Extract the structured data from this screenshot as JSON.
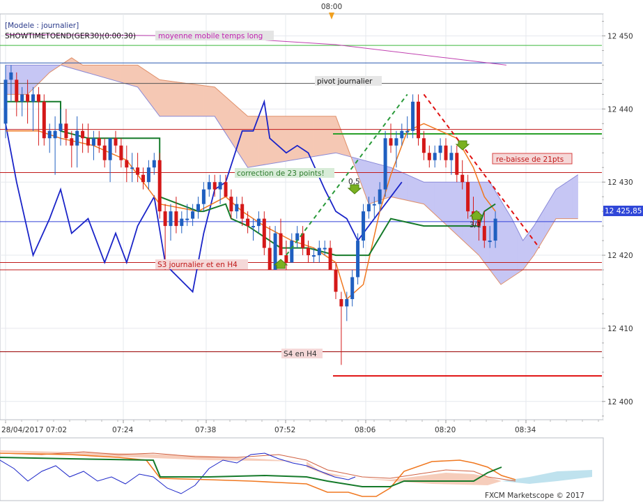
{
  "top_time_marker": "08:00",
  "info": {
    "model": "[Modele : journalier]",
    "symbol": "SHOWTIMETOEND(GER30)(0:00:30)",
    "ma_label": "moyenne mobile temps long"
  },
  "annotations": {
    "pivot": "pivot journalier",
    "correction": "correction de 23 points!",
    "s3": "S3 journalier et en H4",
    "s4": "S4 en H4",
    "rebaisse": "re-baisse de 21pts",
    "fib_a": "0,5",
    "fib_b": "3/1"
  },
  "price_tag": "12 425,85",
  "footer": "FXCM Marketscope © 2017",
  "colors": {
    "up": "#1f5fc0",
    "down": "#d41818",
    "kijun": "#157a2a",
    "tenkan": "#f07820",
    "chikou": "#1a24c8",
    "cloud_red": "#f5c8b4",
    "cloud_blue": "#c6c6f4",
    "ma": "#c040b0"
  },
  "chart_data": {
    "type": "candlestick",
    "ylabels": [
      "12 450",
      "12 440",
      "12 430",
      "12 420",
      "12 410",
      "12 400"
    ],
    "xlabels": [
      "28/04/2017 07:02",
      "07:24",
      "07:38",
      "07:52",
      "08:06",
      "08:20",
      "08:34"
    ],
    "ylim": [
      12397.5,
      12453
    ],
    "levels": {
      "ma_horizontal": 12448.7,
      "blue_level": 12446.3,
      "pivot_journalier": 12443.5,
      "red_r1": 12437.2,
      "green_r": 12436.6,
      "red_r2": 12431.3,
      "s3_a": 12419,
      "s3_b": 12418,
      "s4": 12406.8,
      "s4_future": 12403.5,
      "current": 12424.6
    },
    "candles": [
      {
        "o": 12438,
        "h": 12446,
        "l": 12436,
        "c": 12444
      },
      {
        "o": 12444,
        "h": 12446,
        "l": 12441,
        "c": 12445
      },
      {
        "o": 12444,
        "h": 12445,
        "l": 12439,
        "c": 12441
      },
      {
        "o": 12441,
        "h": 12443,
        "l": 12439,
        "c": 12442
      },
      {
        "o": 12442,
        "h": 12444,
        "l": 12438,
        "c": 12441
      },
      {
        "o": 12441,
        "h": 12443,
        "l": 12437,
        "c": 12442
      },
      {
        "o": 12442,
        "h": 12443,
        "l": 12435,
        "c": 12441
      },
      {
        "o": 12441,
        "h": 12442,
        "l": 12435,
        "c": 12436
      },
      {
        "o": 12436,
        "h": 12438,
        "l": 12434,
        "c": 12437
      },
      {
        "o": 12436,
        "h": 12439,
        "l": 12431,
        "c": 12437
      },
      {
        "o": 12437,
        "h": 12440,
        "l": 12435,
        "c": 12438
      },
      {
        "o": 12438,
        "h": 12440,
        "l": 12435,
        "c": 12436
      },
      {
        "o": 12436,
        "h": 12437,
        "l": 12432,
        "c": 12435
      },
      {
        "o": 12435,
        "h": 12439,
        "l": 12432,
        "c": 12437
      },
      {
        "o": 12437,
        "h": 12438,
        "l": 12434,
        "c": 12436
      },
      {
        "o": 12436,
        "h": 12438,
        "l": 12434,
        "c": 12435
      },
      {
        "o": 12435,
        "h": 12437,
        "l": 12433,
        "c": 12436
      },
      {
        "o": 12436,
        "h": 12437,
        "l": 12434,
        "c": 12435
      },
      {
        "o": 12435,
        "h": 12436,
        "l": 12432,
        "c": 12433
      },
      {
        "o": 12433,
        "h": 12436,
        "l": 12430,
        "c": 12436
      },
      {
        "o": 12436,
        "h": 12437,
        "l": 12434,
        "c": 12435
      },
      {
        "o": 12435,
        "h": 12436,
        "l": 12432,
        "c": 12433
      },
      {
        "o": 12433,
        "h": 12435,
        "l": 12430,
        "c": 12432
      },
      {
        "o": 12432,
        "h": 12434,
        "l": 12430,
        "c": 12432
      },
      {
        "o": 12432,
        "h": 12434,
        "l": 12430,
        "c": 12431
      },
      {
        "o": 12431,
        "h": 12432,
        "l": 12429,
        "c": 12430
      },
      {
        "o": 12430,
        "h": 12433,
        "l": 12429,
        "c": 12432
      },
      {
        "o": 12432,
        "h": 12434,
        "l": 12431,
        "c": 12433
      },
      {
        "o": 12433,
        "h": 12434,
        "l": 12425,
        "c": 12426
      },
      {
        "o": 12426,
        "h": 12427,
        "l": 12418,
        "c": 12424
      },
      {
        "o": 12424,
        "h": 12427,
        "l": 12422,
        "c": 12426
      },
      {
        "o": 12426,
        "h": 12428,
        "l": 12423,
        "c": 12424
      },
      {
        "o": 12424,
        "h": 12426,
        "l": 12423,
        "c": 12425
      },
      {
        "o": 12425,
        "h": 12427,
        "l": 12424,
        "c": 12425
      },
      {
        "o": 12425,
        "h": 12427,
        "l": 12424,
        "c": 12426
      },
      {
        "o": 12426,
        "h": 12428,
        "l": 12425,
        "c": 12427
      },
      {
        "o": 12427,
        "h": 12430,
        "l": 12426,
        "c": 12429
      },
      {
        "o": 12429,
        "h": 12431,
        "l": 12428,
        "c": 12430
      },
      {
        "o": 12430,
        "h": 12431,
        "l": 12428,
        "c": 12429
      },
      {
        "o": 12429,
        "h": 12431,
        "l": 12427,
        "c": 12430
      },
      {
        "o": 12430,
        "h": 12431,
        "l": 12428,
        "c": 12428
      },
      {
        "o": 12428,
        "h": 12429,
        "l": 12425,
        "c": 12426
      },
      {
        "o": 12426,
        "h": 12428,
        "l": 12425,
        "c": 12427
      },
      {
        "o": 12427,
        "h": 12428,
        "l": 12424,
        "c": 12425
      },
      {
        "o": 12425,
        "h": 12426,
        "l": 12423,
        "c": 12424
      },
      {
        "o": 12424,
        "h": 12425,
        "l": 12422,
        "c": 12424
      },
      {
        "o": 12424,
        "h": 12426,
        "l": 12423,
        "c": 12425
      },
      {
        "o": 12425,
        "h": 12426,
        "l": 12420,
        "c": 12421
      },
      {
        "o": 12421,
        "h": 12424,
        "l": 12418,
        "c": 12418
      },
      {
        "o": 12418,
        "h": 12424,
        "l": 12418,
        "c": 12423
      },
      {
        "o": 12423,
        "h": 12425,
        "l": 12420,
        "c": 12420
      },
      {
        "o": 12420,
        "h": 12422,
        "l": 12418,
        "c": 12419
      },
      {
        "o": 12419,
        "h": 12423,
        "l": 12419,
        "c": 12422
      },
      {
        "o": 12422,
        "h": 12424,
        "l": 12421,
        "c": 12423
      },
      {
        "o": 12423,
        "h": 12424,
        "l": 12420,
        "c": 12421
      },
      {
        "o": 12421,
        "h": 12422,
        "l": 12419,
        "c": 12420
      },
      {
        "o": 12420,
        "h": 12421,
        "l": 12419,
        "c": 12420
      },
      {
        "o": 12420,
        "h": 12422,
        "l": 12419,
        "c": 12421
      },
      {
        "o": 12421,
        "h": 12422,
        "l": 12420,
        "c": 12421
      },
      {
        "o": 12421,
        "h": 12422,
        "l": 12418,
        "c": 12418
      },
      {
        "o": 12418,
        "h": 12419,
        "l": 12414,
        "c": 12415
      },
      {
        "o": 12414,
        "h": 12415,
        "l": 12405,
        "c": 12413
      },
      {
        "o": 12413,
        "h": 12415,
        "l": 12411,
        "c": 12414
      },
      {
        "o": 12414,
        "h": 12418,
        "l": 12413,
        "c": 12417
      },
      {
        "o": 12417,
        "h": 12423,
        "l": 12416,
        "c": 12422
      },
      {
        "o": 12422,
        "h": 12427,
        "l": 12421,
        "c": 12426
      },
      {
        "o": 12426,
        "h": 12428,
        "l": 12425,
        "c": 12427
      },
      {
        "o": 12427,
        "h": 12428,
        "l": 12425,
        "c": 12427
      },
      {
        "o": 12427,
        "h": 12430,
        "l": 12426,
        "c": 12429
      },
      {
        "o": 12429,
        "h": 12437,
        "l": 12428,
        "c": 12436
      },
      {
        "o": 12436,
        "h": 12438,
        "l": 12434,
        "c": 12435
      },
      {
        "o": 12435,
        "h": 12437,
        "l": 12432,
        "c": 12436
      },
      {
        "o": 12436,
        "h": 12438,
        "l": 12435,
        "c": 12437
      },
      {
        "o": 12437,
        "h": 12439,
        "l": 12436,
        "c": 12437
      },
      {
        "o": 12437,
        "h": 12442,
        "l": 12436,
        "c": 12441
      },
      {
        "o": 12441,
        "h": 12442,
        "l": 12435,
        "c": 12436
      },
      {
        "o": 12436,
        "h": 12437,
        "l": 12433,
        "c": 12434
      },
      {
        "o": 12434,
        "h": 12435,
        "l": 12432,
        "c": 12433
      },
      {
        "o": 12433,
        "h": 12435,
        "l": 12432,
        "c": 12434
      },
      {
        "o": 12434,
        "h": 12436,
        "l": 12433,
        "c": 12435
      },
      {
        "o": 12435,
        "h": 12436,
        "l": 12432,
        "c": 12433
      },
      {
        "o": 12433,
        "h": 12435,
        "l": 12431,
        "c": 12434
      },
      {
        "o": 12434,
        "h": 12435,
        "l": 12430,
        "c": 12431
      },
      {
        "o": 12431,
        "h": 12433,
        "l": 12429,
        "c": 12430
      },
      {
        "o": 12430,
        "h": 12431,
        "l": 12425,
        "c": 12426
      },
      {
        "o": 12426,
        "h": 12428,
        "l": 12424,
        "c": 12425
      },
      {
        "o": 12425,
        "h": 12426,
        "l": 12422,
        "c": 12424
      },
      {
        "o": 12424,
        "h": 12426,
        "l": 12421,
        "c": 12422
      },
      {
        "o": 12422,
        "h": 12424,
        "l": 12421,
        "c": 12422
      },
      {
        "o": 12422,
        "h": 12426,
        "l": 12421,
        "c": 12425
      }
    ],
    "indicators": {
      "kijun": [
        [
          0,
          12441
        ],
        [
          10,
          12441
        ],
        [
          10,
          12437
        ],
        [
          15,
          12436
        ],
        [
          28,
          12436
        ],
        [
          28,
          12428
        ],
        [
          35,
          12426
        ],
        [
          36,
          12426
        ],
        [
          40,
          12427
        ],
        [
          41,
          12425
        ],
        [
          44,
          12424
        ],
        [
          46,
          12423
        ],
        [
          50,
          12421
        ],
        [
          55,
          12421
        ],
        [
          60,
          12420
        ],
        [
          66,
          12420
        ],
        [
          70,
          12425
        ],
        [
          76,
          12424
        ],
        [
          86,
          12424
        ],
        [
          87,
          12426
        ],
        [
          89,
          12427
        ]
      ],
      "tenkan": [
        [
          0,
          12437
        ],
        [
          6,
          12437
        ],
        [
          10,
          12436
        ],
        [
          16,
          12435
        ],
        [
          22,
          12433
        ],
        [
          28,
          12427
        ],
        [
          35,
          12426
        ],
        [
          40,
          12428
        ],
        [
          43,
          12426
        ],
        [
          47,
          12424
        ],
        [
          52,
          12422
        ],
        [
          56,
          12421
        ],
        [
          60,
          12419
        ],
        [
          62,
          12414
        ],
        [
          65,
          12416
        ],
        [
          68,
          12426
        ],
        [
          70,
          12431
        ],
        [
          73,
          12437
        ],
        [
          76,
          12438
        ],
        [
          79,
          12437
        ],
        [
          82,
          12436
        ],
        [
          85,
          12432
        ],
        [
          87,
          12428
        ],
        [
          89,
          12426
        ]
      ],
      "chikou": [
        [
          0,
          12438
        ],
        [
          2,
          12430
        ],
        [
          5,
          12420
        ],
        [
          8,
          12425
        ],
        [
          10,
          12429
        ],
        [
          12,
          12423
        ],
        [
          15,
          12425
        ],
        [
          18,
          12419
        ],
        [
          20,
          12423
        ],
        [
          22,
          12419
        ],
        [
          24,
          12424
        ],
        [
          27,
          12428
        ],
        [
          29,
          12419
        ],
        [
          30,
          12418
        ],
        [
          34,
          12415
        ],
        [
          36,
          12423
        ],
        [
          38,
          12429
        ],
        [
          40,
          12430
        ],
        [
          43,
          12437
        ],
        [
          45,
          12437
        ],
        [
          47,
          12441
        ],
        [
          48,
          12436
        ],
        [
          51,
          12434
        ],
        [
          53,
          12435
        ],
        [
          55,
          12434
        ],
        [
          58,
          12429
        ],
        [
          60,
          12426
        ],
        [
          62,
          12425
        ],
        [
          64,
          12422
        ],
        [
          66,
          12424
        ],
        [
          68,
          12426
        ],
        [
          70,
          12428
        ],
        [
          72,
          12430
        ]
      ],
      "senkou_a": [
        [
          0,
          12446
        ],
        [
          8,
          12446
        ],
        [
          10,
          12446
        ],
        [
          24,
          12443
        ],
        [
          28,
          12439
        ],
        [
          38,
          12439
        ],
        [
          44,
          12432
        ],
        [
          60,
          12434
        ],
        [
          70,
          12432
        ],
        [
          76,
          12430
        ],
        [
          88,
          12430
        ],
        [
          92,
          12425
        ],
        [
          94,
          12422
        ],
        [
          96,
          12424
        ],
        [
          100,
          12429
        ],
        [
          104,
          12431
        ]
      ],
      "senkou_b": [
        [
          0,
          12442
        ],
        [
          4,
          12442
        ],
        [
          8,
          12445
        ],
        [
          12,
          12447
        ],
        [
          14,
          12446
        ],
        [
          24,
          12446
        ],
        [
          28,
          12444
        ],
        [
          38,
          12443
        ],
        [
          44,
          12439
        ],
        [
          60,
          12439
        ],
        [
          66,
          12427
        ],
        [
          70,
          12428
        ],
        [
          76,
          12427
        ],
        [
          86,
          12420
        ],
        [
          90,
          12416
        ],
        [
          94,
          12418
        ],
        [
          96,
          12420
        ],
        [
          100,
          12425
        ],
        [
          104,
          12425
        ]
      ]
    }
  }
}
